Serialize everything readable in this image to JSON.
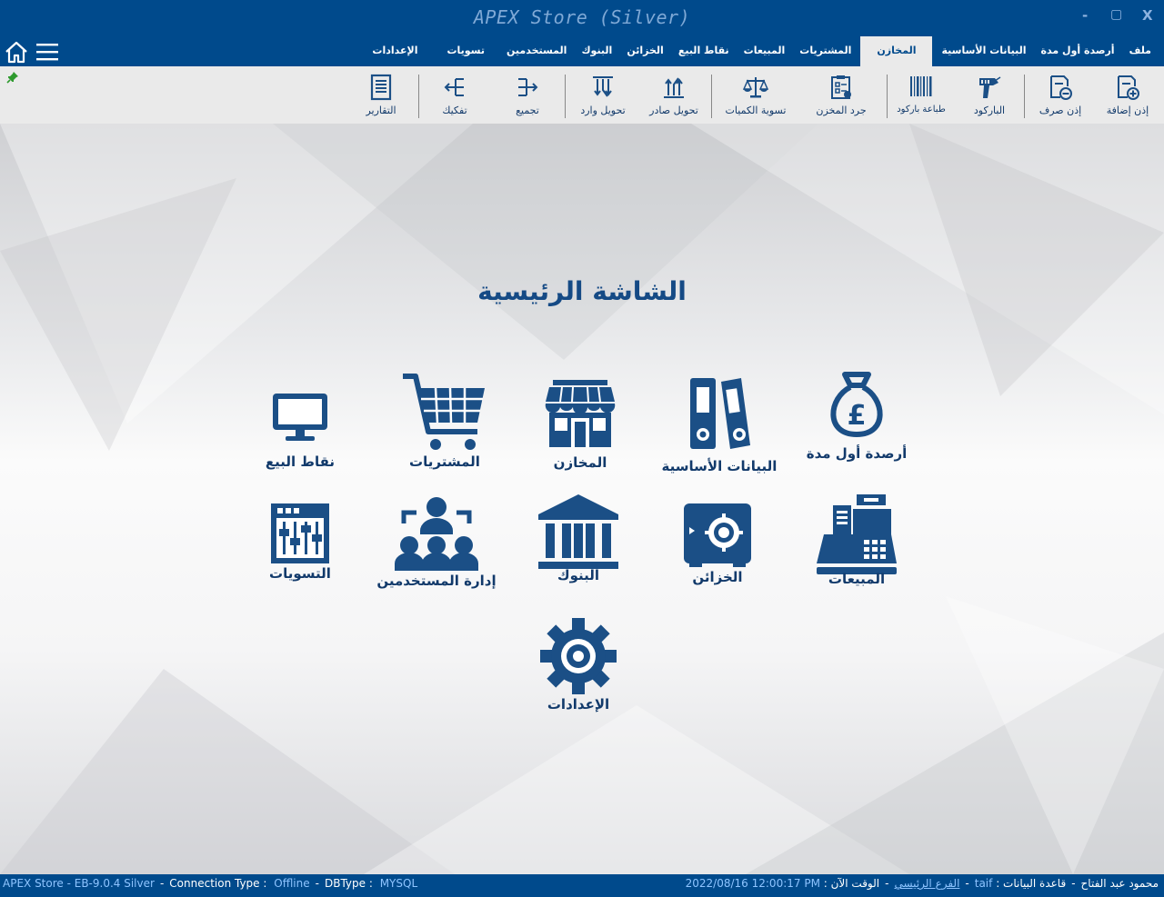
{
  "window": {
    "title": "APEX Store (Silver)",
    "minimize": "-",
    "maximize": "▢",
    "close": "X"
  },
  "menu": {
    "tabs": [
      {
        "id": "file",
        "label": "ملف"
      },
      {
        "id": "opening",
        "label": "أرصدة أول مدة"
      },
      {
        "id": "basic",
        "label": "البيانات الأساسية"
      },
      {
        "id": "stores",
        "label": "المخازن",
        "active": true
      },
      {
        "id": "purchases",
        "label": "المشتريات"
      },
      {
        "id": "sales",
        "label": "المبيعات"
      },
      {
        "id": "pos",
        "label": "نقاط البيع"
      },
      {
        "id": "safes",
        "label": "الخزائن"
      },
      {
        "id": "banks",
        "label": "البنوك"
      },
      {
        "id": "users",
        "label": "المستخدمين"
      },
      {
        "id": "adjust",
        "label": "تسويات"
      },
      {
        "id": "settings",
        "label": "الإعدادات"
      }
    ]
  },
  "ribbon": {
    "buttons": [
      {
        "id": "add-permit",
        "label": "إذن إضافة",
        "icon": "add-doc-icon"
      },
      {
        "id": "issue-permit",
        "label": "إذن صرف",
        "icon": "minus-doc-icon"
      },
      {
        "id": "barcode",
        "label": "الباركود",
        "icon": "barcode-scanner-icon"
      },
      {
        "id": "print-barcode",
        "label": "طباعة باركود",
        "icon": "barcode-icon"
      },
      {
        "id": "inventory",
        "label": "جرد المخزن",
        "icon": "clipboard-icon"
      },
      {
        "id": "qty-adjust",
        "label": "تسوية الكميات",
        "icon": "scale-icon"
      },
      {
        "id": "transfer-out",
        "label": "تحويل صادر",
        "icon": "transfer-out-icon"
      },
      {
        "id": "transfer-in",
        "label": "تحويل وارد",
        "icon": "transfer-in-icon"
      },
      {
        "id": "assemble",
        "label": "تجميع",
        "icon": "assemble-icon"
      },
      {
        "id": "disassemble",
        "label": "تفكيك",
        "icon": "disassemble-icon"
      },
      {
        "id": "reports",
        "label": "التقارير",
        "icon": "report-icon"
      }
    ]
  },
  "main": {
    "title": "الشاشة الرئيسية",
    "tiles": [
      {
        "id": "opening-balances",
        "label": "أرصدة أول مدة",
        "icon": "money-bag-icon"
      },
      {
        "id": "basic-data",
        "label": "البيانات الأساسية",
        "icon": "binders-icon"
      },
      {
        "id": "stores",
        "label": "المخازن",
        "icon": "store-icon"
      },
      {
        "id": "purchases",
        "label": "المشتريات",
        "icon": "cart-icon"
      },
      {
        "id": "pos",
        "label": "نقاط البيع",
        "icon": "monitor-icon"
      },
      {
        "id": "sales",
        "label": "المبيعات",
        "icon": "cash-register-icon"
      },
      {
        "id": "safes",
        "label": "الخزائن",
        "icon": "safe-icon"
      },
      {
        "id": "banks",
        "label": "البنوك",
        "icon": "bank-icon"
      },
      {
        "id": "user-management",
        "label": "إدارة المستخدمين",
        "icon": "users-icon"
      },
      {
        "id": "adjustments",
        "label": "التسويات",
        "icon": "sliders-icon"
      },
      {
        "id": "settings",
        "label": "الإعدادات",
        "icon": "gear-icon"
      }
    ]
  },
  "status": {
    "app_version": "APEX Store - EB-9.0.4 Silver",
    "sep": "-",
    "conn_label": "Connection Type :",
    "conn_value": "Offline",
    "db_label": "DBType :",
    "db_value": "MYSQL",
    "user": "محمود عبد الفتاح",
    "db_name_label": "قاعدة البيانات :",
    "db_name_value": "taif",
    "branch": "الفرع الرئيسي",
    "time_label": "الوقت الآن :",
    "time_value": "2022/08/16 12:00:17 PM"
  },
  "colors": {
    "primary": "#004a8c",
    "icon": "#1b4f86",
    "ribbon_bg": "#eaeaea",
    "status_highlight": "#8ec4ff"
  }
}
